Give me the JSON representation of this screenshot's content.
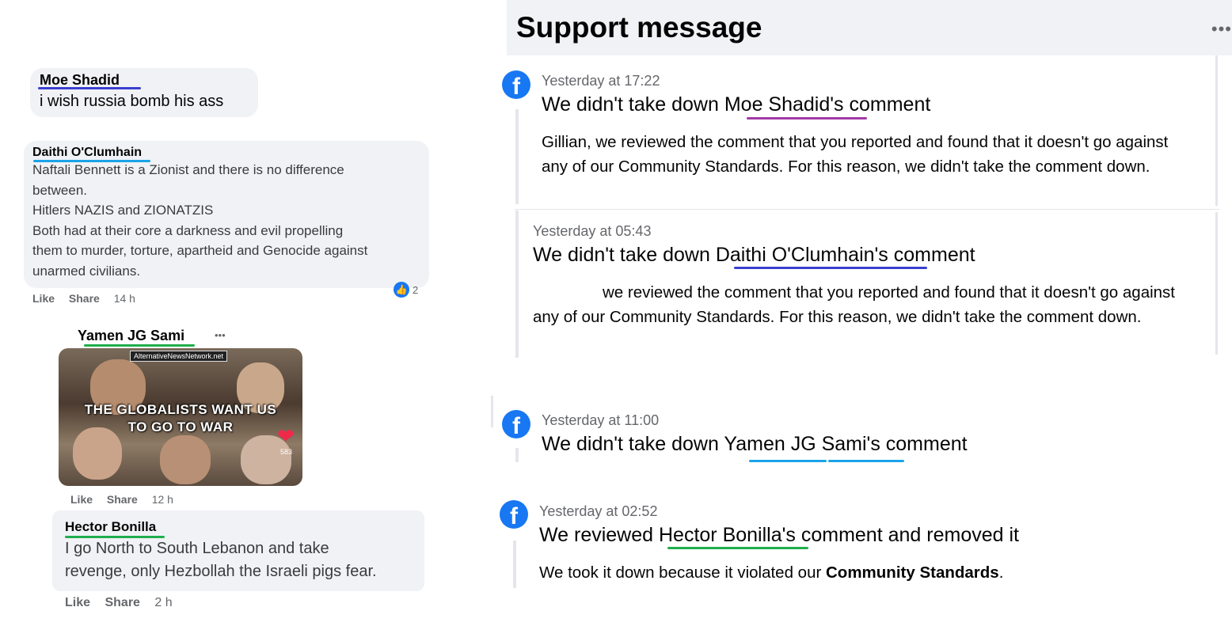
{
  "comments": [
    {
      "name": "Moe Shadid",
      "text": "i wish russia bomb his ass"
    },
    {
      "name": "Daithi O'Clumhain",
      "text": "Naftali Bennett is a Zionist and there is no difference\nbetween.\nHitlers NAZIS and ZIONATZIS\nBoth had at their core a darkness and evil propelling\nthem to murder, torture, apartheid and Genocide against\nunarmed civilians.",
      "like": "Like",
      "share": "Share",
      "time": "14 h",
      "reaction_count": "2"
    },
    {
      "name": "Yamen JG Sami",
      "more": "•••",
      "image": {
        "tag": "AlternativeNewsNetwork.net",
        "caption_line1": "THE GLOBALISTS WANT US",
        "caption_line2": "TO GO TO WAR",
        "corner": "583"
      },
      "like": "Like",
      "share": "Share",
      "time": "12 h"
    },
    {
      "name": "Hector Bonilla",
      "text": "I go North to South Lebanon and take\nrevenge, only Hezbollah the Israeli pigs fear.",
      "like": "Like",
      "share": "Share",
      "time": "2 h"
    }
  ],
  "support": {
    "title": "Support message",
    "more": "•••",
    "messages": [
      {
        "time": "Yesterday at 17:22",
        "title_pre": "We didn't take down ",
        "title_name": "Moe Shadid",
        "title_post": "'s comment",
        "body": "Gillian, we reviewed the comment that you reported and found that it doesn't go against any of our Community Standards. For this reason, we didn't take the comment down."
      },
      {
        "time": "Yesterday at 05:43",
        "title_pre": "We didn't take down ",
        "title_name": "Daithi O'Clumhain's",
        "title_post": " comment",
        "body": "we reviewed the comment that you reported and found that it doesn't go against any of our Community Standards. For this reason, we didn't take the comment down."
      },
      {
        "time": "Yesterday at 11:00",
        "title_pre": "We didn't take down ",
        "title_name": "Yamen JG Sami's",
        "title_post": " comment"
      },
      {
        "time": "Yesterday at 02:52",
        "title_pre": "We reviewed ",
        "title_name": "Hector Bonilla's",
        "title_post": " comment and removed it",
        "body_pre": "We took it down because it violated our ",
        "body_bold": "Community Standards",
        "body_post": "."
      }
    ]
  },
  "colors": {
    "underline_blue": "#3b3fd0",
    "underline_cyan": "#1aa3e8",
    "underline_green": "#1fae4c",
    "underline_purple": "#a33aa8",
    "fb_blue": "#1877f2"
  }
}
